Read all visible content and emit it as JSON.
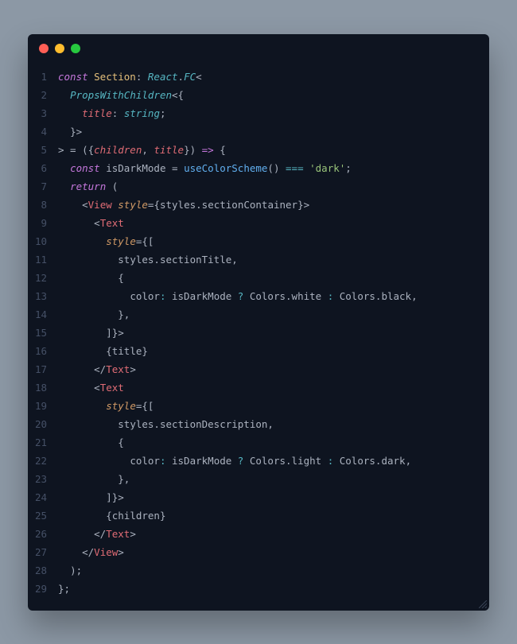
{
  "window": {
    "traffic_lights": [
      "close",
      "minimize",
      "zoom"
    ]
  },
  "code": {
    "lines": [
      [
        {
          "t": "const ",
          "c": "tk-kw"
        },
        {
          "t": "Section",
          "c": "tk-var"
        },
        {
          "t": ":",
          "c": "tk-punc"
        },
        {
          "t": " ",
          "c": "tk-plain"
        },
        {
          "t": "React",
          "c": "tk-type"
        },
        {
          "t": ".",
          "c": "tk-punc"
        },
        {
          "t": "FC",
          "c": "tk-type"
        },
        {
          "t": "<",
          "c": "tk-punc"
        }
      ],
      [
        {
          "t": "  ",
          "c": "tk-plain"
        },
        {
          "t": "PropsWithChildren",
          "c": "tk-type"
        },
        {
          "t": "<{",
          "c": "tk-punc"
        }
      ],
      [
        {
          "t": "    ",
          "c": "tk-plain"
        },
        {
          "t": "title",
          "c": "tk-prop"
        },
        {
          "t": ":",
          "c": "tk-punc"
        },
        {
          "t": " ",
          "c": "tk-plain"
        },
        {
          "t": "string",
          "c": "tk-type"
        },
        {
          "t": ";",
          "c": "tk-punc"
        }
      ],
      [
        {
          "t": "  ",
          "c": "tk-plain"
        },
        {
          "t": "}>",
          "c": "tk-punc"
        }
      ],
      [
        {
          "t": "> = ({",
          "c": "tk-punc"
        },
        {
          "t": "children",
          "c": "tk-prop"
        },
        {
          "t": ", ",
          "c": "tk-punc"
        },
        {
          "t": "title",
          "c": "tk-prop"
        },
        {
          "t": "}) ",
          "c": "tk-punc"
        },
        {
          "t": "=>",
          "c": "tk-arrow"
        },
        {
          "t": " {",
          "c": "tk-punc"
        }
      ],
      [
        {
          "t": "  ",
          "c": "tk-plain"
        },
        {
          "t": "const ",
          "c": "tk-kw"
        },
        {
          "t": "isDarkMode",
          "c": "tk-plain"
        },
        {
          "t": " = ",
          "c": "tk-punc"
        },
        {
          "t": "useColorScheme",
          "c": "tk-fn"
        },
        {
          "t": "()",
          "c": "tk-punc"
        },
        {
          "t": " ",
          "c": "tk-plain"
        },
        {
          "t": "===",
          "c": "tk-op"
        },
        {
          "t": " ",
          "c": "tk-plain"
        },
        {
          "t": "'dark'",
          "c": "tk-str"
        },
        {
          "t": ";",
          "c": "tk-punc"
        }
      ],
      [
        {
          "t": "  ",
          "c": "tk-plain"
        },
        {
          "t": "return ",
          "c": "tk-kw"
        },
        {
          "t": "(",
          "c": "tk-punc"
        }
      ],
      [
        {
          "t": "    ",
          "c": "tk-plain"
        },
        {
          "t": "<",
          "c": "tk-punc"
        },
        {
          "t": "View",
          "c": "tk-tag"
        },
        {
          "t": " ",
          "c": "tk-plain"
        },
        {
          "t": "style",
          "c": "tk-attr"
        },
        {
          "t": "=",
          "c": "tk-punc"
        },
        {
          "t": "{",
          "c": "tk-punc"
        },
        {
          "t": "styles",
          "c": "tk-plain"
        },
        {
          "t": ".",
          "c": "tk-punc"
        },
        {
          "t": "sectionContainer",
          "c": "tk-plain"
        },
        {
          "t": "}",
          "c": "tk-punc"
        },
        {
          "t": ">",
          "c": "tk-punc"
        }
      ],
      [
        {
          "t": "      ",
          "c": "tk-plain"
        },
        {
          "t": "<",
          "c": "tk-punc"
        },
        {
          "t": "Text",
          "c": "tk-tag"
        }
      ],
      [
        {
          "t": "        ",
          "c": "tk-plain"
        },
        {
          "t": "style",
          "c": "tk-attr"
        },
        {
          "t": "=",
          "c": "tk-punc"
        },
        {
          "t": "{[",
          "c": "tk-punc"
        }
      ],
      [
        {
          "t": "          ",
          "c": "tk-plain"
        },
        {
          "t": "styles",
          "c": "tk-plain"
        },
        {
          "t": ".",
          "c": "tk-punc"
        },
        {
          "t": "sectionTitle",
          "c": "tk-plain"
        },
        {
          "t": ",",
          "c": "tk-punc"
        }
      ],
      [
        {
          "t": "          ",
          "c": "tk-plain"
        },
        {
          "t": "{",
          "c": "tk-punc"
        }
      ],
      [
        {
          "t": "            ",
          "c": "tk-plain"
        },
        {
          "t": "color",
          "c": "tk-plain"
        },
        {
          "t": ":",
          "c": "tk-op"
        },
        {
          "t": " isDarkMode ",
          "c": "tk-plain"
        },
        {
          "t": "?",
          "c": "tk-op"
        },
        {
          "t": " Colors",
          "c": "tk-plain"
        },
        {
          "t": ".",
          "c": "tk-punc"
        },
        {
          "t": "white ",
          "c": "tk-plain"
        },
        {
          "t": ":",
          "c": "tk-op"
        },
        {
          "t": " Colors",
          "c": "tk-plain"
        },
        {
          "t": ".",
          "c": "tk-punc"
        },
        {
          "t": "black",
          "c": "tk-plain"
        },
        {
          "t": ",",
          "c": "tk-punc"
        }
      ],
      [
        {
          "t": "          ",
          "c": "tk-plain"
        },
        {
          "t": "},",
          "c": "tk-punc"
        }
      ],
      [
        {
          "t": "        ",
          "c": "tk-plain"
        },
        {
          "t": "]}",
          "c": "tk-punc"
        },
        {
          "t": ">",
          "c": "tk-punc"
        }
      ],
      [
        {
          "t": "        ",
          "c": "tk-plain"
        },
        {
          "t": "{",
          "c": "tk-punc"
        },
        {
          "t": "title",
          "c": "tk-plain"
        },
        {
          "t": "}",
          "c": "tk-punc"
        }
      ],
      [
        {
          "t": "      ",
          "c": "tk-plain"
        },
        {
          "t": "</",
          "c": "tk-punc"
        },
        {
          "t": "Text",
          "c": "tk-tag"
        },
        {
          "t": ">",
          "c": "tk-punc"
        }
      ],
      [
        {
          "t": "      ",
          "c": "tk-plain"
        },
        {
          "t": "<",
          "c": "tk-punc"
        },
        {
          "t": "Text",
          "c": "tk-tag"
        }
      ],
      [
        {
          "t": "        ",
          "c": "tk-plain"
        },
        {
          "t": "style",
          "c": "tk-attr"
        },
        {
          "t": "=",
          "c": "tk-punc"
        },
        {
          "t": "{[",
          "c": "tk-punc"
        }
      ],
      [
        {
          "t": "          ",
          "c": "tk-plain"
        },
        {
          "t": "styles",
          "c": "tk-plain"
        },
        {
          "t": ".",
          "c": "tk-punc"
        },
        {
          "t": "sectionDescription",
          "c": "tk-plain"
        },
        {
          "t": ",",
          "c": "tk-punc"
        }
      ],
      [
        {
          "t": "          ",
          "c": "tk-plain"
        },
        {
          "t": "{",
          "c": "tk-punc"
        }
      ],
      [
        {
          "t": "            ",
          "c": "tk-plain"
        },
        {
          "t": "color",
          "c": "tk-plain"
        },
        {
          "t": ":",
          "c": "tk-op"
        },
        {
          "t": " isDarkMode ",
          "c": "tk-plain"
        },
        {
          "t": "?",
          "c": "tk-op"
        },
        {
          "t": " Colors",
          "c": "tk-plain"
        },
        {
          "t": ".",
          "c": "tk-punc"
        },
        {
          "t": "light ",
          "c": "tk-plain"
        },
        {
          "t": ":",
          "c": "tk-op"
        },
        {
          "t": " Colors",
          "c": "tk-plain"
        },
        {
          "t": ".",
          "c": "tk-punc"
        },
        {
          "t": "dark",
          "c": "tk-plain"
        },
        {
          "t": ",",
          "c": "tk-punc"
        }
      ],
      [
        {
          "t": "          ",
          "c": "tk-plain"
        },
        {
          "t": "},",
          "c": "tk-punc"
        }
      ],
      [
        {
          "t": "        ",
          "c": "tk-plain"
        },
        {
          "t": "]}",
          "c": "tk-punc"
        },
        {
          "t": ">",
          "c": "tk-punc"
        }
      ],
      [
        {
          "t": "        ",
          "c": "tk-plain"
        },
        {
          "t": "{",
          "c": "tk-punc"
        },
        {
          "t": "children",
          "c": "tk-plain"
        },
        {
          "t": "}",
          "c": "tk-punc"
        }
      ],
      [
        {
          "t": "      ",
          "c": "tk-plain"
        },
        {
          "t": "</",
          "c": "tk-punc"
        },
        {
          "t": "Text",
          "c": "tk-tag"
        },
        {
          "t": ">",
          "c": "tk-punc"
        }
      ],
      [
        {
          "t": "    ",
          "c": "tk-plain"
        },
        {
          "t": "</",
          "c": "tk-punc"
        },
        {
          "t": "View",
          "c": "tk-tag"
        },
        {
          "t": ">",
          "c": "tk-punc"
        }
      ],
      [
        {
          "t": "  ",
          "c": "tk-plain"
        },
        {
          "t": ");",
          "c": "tk-punc"
        }
      ],
      [
        {
          "t": "",
          "c": "tk-plain"
        },
        {
          "t": "};",
          "c": "tk-punc"
        }
      ]
    ]
  }
}
